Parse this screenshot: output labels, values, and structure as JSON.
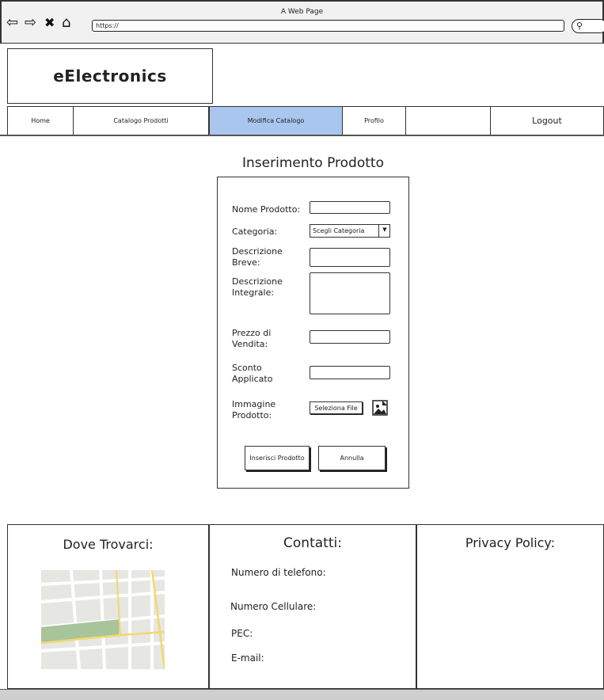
{
  "browser": {
    "window_title": "A Web Page",
    "url": "https://"
  },
  "header": {
    "logo_text": "eElectronics"
  },
  "nav": {
    "home": "Home",
    "catalog": "Catalogo Prodotti",
    "edit_catalog": "Modifica Catalogo",
    "profile": "Profilo",
    "logout": "Logout",
    "active_color": "#a9c6ee"
  },
  "form": {
    "title": "Inserimento Prodotto",
    "name_label": "Nome Prodotto:",
    "category_label": "Categoria:",
    "category_selected": "Scegli Categoria",
    "short_desc_label_1": "Descrizione",
    "short_desc_label_2": "Breve:",
    "full_desc_label_1": "Descrizione",
    "full_desc_label_2": "Integrale:",
    "price_label_1": "Prezzo di",
    "price_label_2": "Vendita:",
    "discount_label_1": "Sconto",
    "discount_label_2": "Applicato",
    "image_label_1": "Immagine",
    "image_label_2": "Prodotto:",
    "select_file_button": "Seleziona File",
    "insert_button": "Inserisci Prodotto",
    "cancel_button": "Annulla"
  },
  "footer": {
    "where_title": "Dove Trovarci:",
    "contacts_title": "Contatti:",
    "phone_label": "Numero di telefono:",
    "mobile_label": "Numero Cellulare:",
    "pec_label": "PEC:",
    "email_label": "E-mail:",
    "privacy_title": "Privacy Policy:"
  }
}
